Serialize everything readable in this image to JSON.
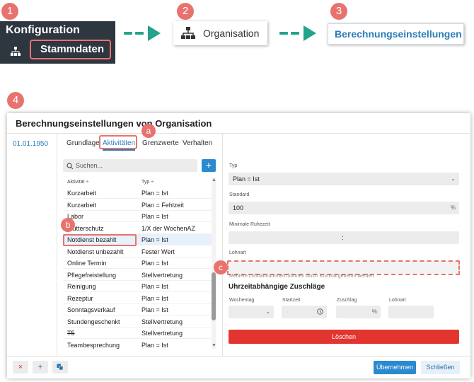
{
  "steps": [
    "1",
    "2",
    "3",
    "4"
  ],
  "letters": {
    "a": "a",
    "b": "b",
    "c": "c"
  },
  "nav": {
    "menu_title": "Konfiguration",
    "menu_item": "Stammdaten",
    "org_label": "Organisation",
    "ber_label": "Berechnungseinstellungen"
  },
  "dialog": {
    "title": "Berechnungseinstellungen von Organisation",
    "date": "01.01.1950",
    "tabs": [
      "Grundlage",
      "Aktivitäten",
      "Grenzwerte",
      "Verhalten"
    ],
    "active_tab": "Aktivitäten",
    "search_placeholder": "Suchen...",
    "plus": "+",
    "list": {
      "col_activity": "Aktivität ÷",
      "col_type": "Typ ÷",
      "rows": [
        {
          "activity": "Kurzarbeit",
          "type": "Plan = Ist"
        },
        {
          "activity": "Kurzarbeit",
          "type": "Plan = Fehlzeit"
        },
        {
          "activity": "Labor",
          "type": "Plan = Ist"
        },
        {
          "activity": "Mutterschutz",
          "type": "1/X der WochenAZ"
        },
        {
          "activity": "Notdienst bezahlt",
          "type": "Plan = Ist"
        },
        {
          "activity": "Notdienst unbezahlt",
          "type": "Fester Wert"
        },
        {
          "activity": "Online Termin",
          "type": "Plan = Ist"
        },
        {
          "activity": "Pflegefreistellung",
          "type": "Stellvertretung"
        },
        {
          "activity": "Reinigung",
          "type": "Plan = Ist"
        },
        {
          "activity": "Rezeptur",
          "type": "Plan = Ist"
        },
        {
          "activity": "Sonntagsverkauf",
          "type": "Plan = Ist"
        },
        {
          "activity": "Stundengeschenkt",
          "type": "Stellvertretung"
        },
        {
          "activity": "T5",
          "type": "Stellvertretung"
        },
        {
          "activity": "Teambesprechung",
          "type": "Plan = Ist"
        }
      ],
      "selected_index": 4,
      "strike_index": 12
    },
    "form": {
      "typ_label": "Typ",
      "typ_value": "Plan = Ist",
      "standard_label": "Standard",
      "standard_value": "100",
      "standard_unit": "%",
      "ruhezeit_label": "Minimale Ruhezeit",
      "ruhezeit_sep": ":",
      "lohnart_label": "Lohnart",
      "lohnart_hint": "Mehrere Lohnartnummern können durch Komma getrennt werden",
      "section_title": "Uhrzeitabhängige Zuschläge",
      "col_wochentag": "Wochentag",
      "col_startzeit": "Startzeit",
      "col_zuschlag": "Zuschlag",
      "col_lohnart": "Lohnart",
      "zuschlag_unit": "%",
      "delete_label": "Löschen"
    },
    "footer": {
      "delete_icon": "×",
      "add_icon": "+",
      "copy_icon": "copy-icon",
      "apply_label": "Übernehmen",
      "close_label": "Schließen"
    }
  },
  "colors": {
    "accent_red": "#e8736e",
    "arrow_green": "#22a38a",
    "primary_blue": "#2a8ad0",
    "danger_red": "#e3352f",
    "menu_dark": "#2e3640"
  }
}
